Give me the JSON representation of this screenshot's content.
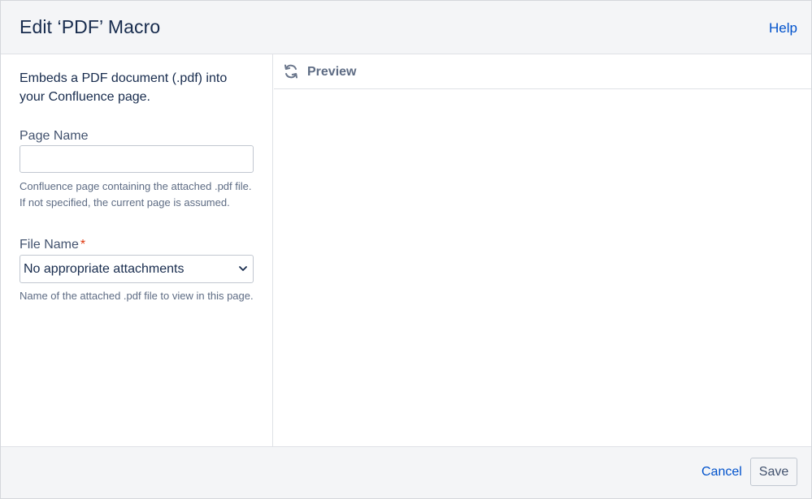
{
  "dialog": {
    "title": "Edit ‘PDF’ Macro",
    "help_label": "Help"
  },
  "form": {
    "description": "Embeds a PDF document (.pdf) into your Confluence page.",
    "page_name": {
      "label": "Page Name",
      "value": "",
      "help": "Confluence page containing the attached .pdf file. If not specified, the current page is assumed."
    },
    "file_name": {
      "label": "File Name",
      "required_mark": "*",
      "selected": "No appropriate attachments",
      "help": "Name of the attached .pdf file to view in this page."
    }
  },
  "preview": {
    "label": "Preview",
    "icon": "refresh-icon"
  },
  "footer": {
    "cancel_label": "Cancel",
    "save_label": "Save"
  },
  "colors": {
    "link": "#0052cc",
    "required": "#de350b",
    "header_bg": "#f4f5f7"
  }
}
